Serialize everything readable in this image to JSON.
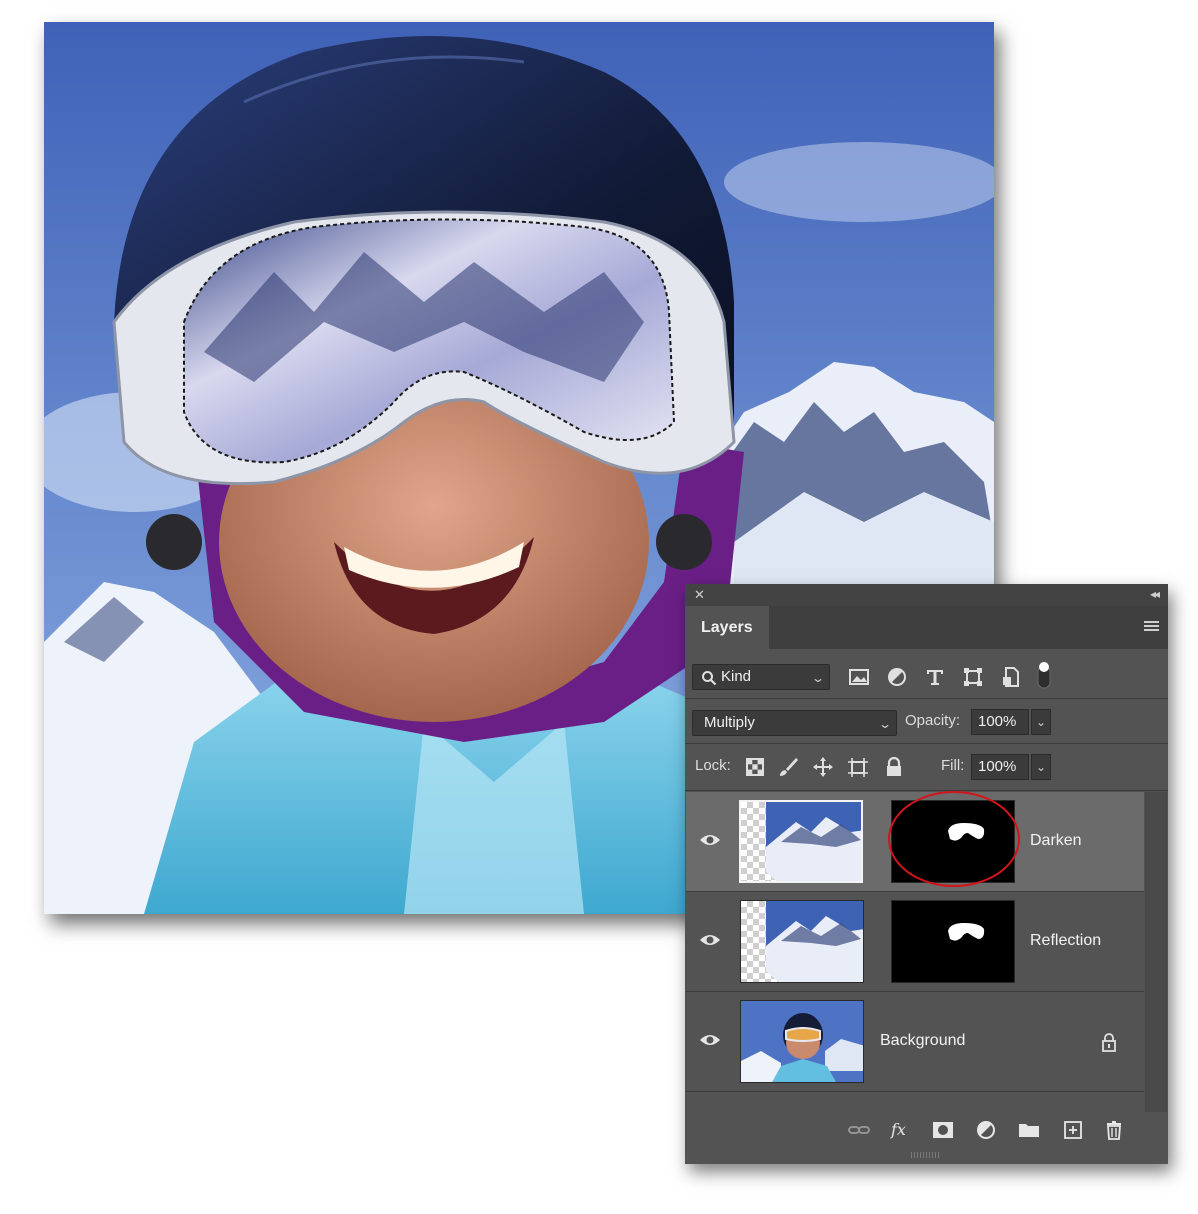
{
  "panel": {
    "tab_title": "Layers",
    "filter": {
      "label": "Kind"
    },
    "blend_mode": "Multiply",
    "opacity": {
      "label": "Opacity:",
      "value": "100%"
    },
    "lock": {
      "label": "Lock:"
    },
    "fill": {
      "label": "Fill:",
      "value": "100%"
    },
    "layers": [
      {
        "name": "Darken",
        "selected": true,
        "has_mask": true
      },
      {
        "name": "Reflection",
        "selected": false,
        "has_mask": true
      },
      {
        "name": "Background",
        "selected": false,
        "has_mask": false,
        "locked": true
      }
    ],
    "icons": {
      "titlebar": [
        "close-icon",
        "collapse-icon"
      ],
      "filters": [
        "image-filter-icon",
        "adjustment-filter-icon",
        "type-filter-icon",
        "shape-filter-icon",
        "smart-object-filter-icon",
        "filter-toggle-icon"
      ],
      "lock": [
        "lock-pixels-icon",
        "lock-image-icon",
        "lock-position-icon",
        "lock-artboard-icon",
        "lock-all-icon"
      ],
      "bottom": [
        "link-layers-icon",
        "fx-icon",
        "add-mask-icon",
        "new-adjustment-icon",
        "new-group-icon",
        "new-layer-icon",
        "delete-layer-icon"
      ]
    }
  },
  "colors": {
    "panel_bg": "#535353",
    "selected_row": "#6b6b6b",
    "annotation_circle": "#d2141b"
  }
}
